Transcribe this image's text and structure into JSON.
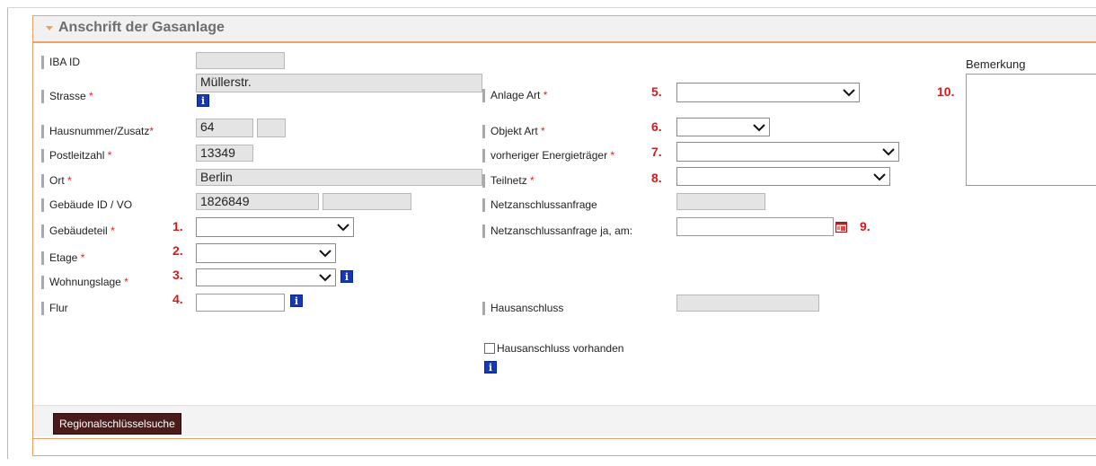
{
  "section": {
    "title": "Anschrift der Gasanlage"
  },
  "required_mark": "*",
  "left": {
    "iba_id": {
      "label": "IBA ID",
      "value": ""
    },
    "strasse": {
      "label": "Strasse",
      "value": "Müllerstr."
    },
    "hausnummer": {
      "label": "Hausnummer/Zusatz",
      "value": "64",
      "zusatz": ""
    },
    "plz": {
      "label": "Postleitzahl",
      "value": "13349"
    },
    "ort": {
      "label": "Ort",
      "value": "Berlin"
    },
    "gebaeude_id": {
      "label": "Gebäude ID / VO",
      "value": "1826849",
      "vo": ""
    },
    "gebaeudeteil": {
      "label": "Gebäudeteil",
      "number": "1.",
      "value": ""
    },
    "etage": {
      "label": "Etage",
      "number": "2.",
      "value": ""
    },
    "wohnungslage": {
      "label": "Wohnungslage",
      "number": "3.",
      "value": ""
    },
    "flur": {
      "label": "Flur",
      "number": "4.",
      "value": ""
    }
  },
  "middle": {
    "anlage_art": {
      "label": "Anlage Art",
      "number": "5.",
      "value": ""
    },
    "objekt_art": {
      "label": "Objekt Art",
      "number": "6.",
      "value": ""
    },
    "energietraeger": {
      "label": "vorheriger Energieträger",
      "number": "7.",
      "value": ""
    },
    "teilnetz": {
      "label": "Teilnetz",
      "number": "8.",
      "value": ""
    },
    "netzanschlussanfrage": {
      "label": "Netzanschlussanfrage",
      "value": ""
    },
    "netzanschlussanfrage_am": {
      "label": "Netzanschlussanfrage ja, am:",
      "number": "9.",
      "value": ""
    },
    "hausanschluss": {
      "label": "Hausanschluss",
      "value": ""
    },
    "hausanschluss_vorhanden": {
      "label": "Hausanschluss vorhanden",
      "checked": false
    }
  },
  "right": {
    "bemerkung": {
      "label": "Bemerkung",
      "number": "10.",
      "value": ""
    }
  },
  "info_icon_glyph": "i",
  "footer": {
    "button_label": "Regionalschlüsselsuche"
  },
  "colors": {
    "accent_orange": "#e7a36a",
    "required_red": "#e02020",
    "number_red": "#d01c1c",
    "info_blue": "#1438b8",
    "button_bg": "#4a1b1b"
  }
}
